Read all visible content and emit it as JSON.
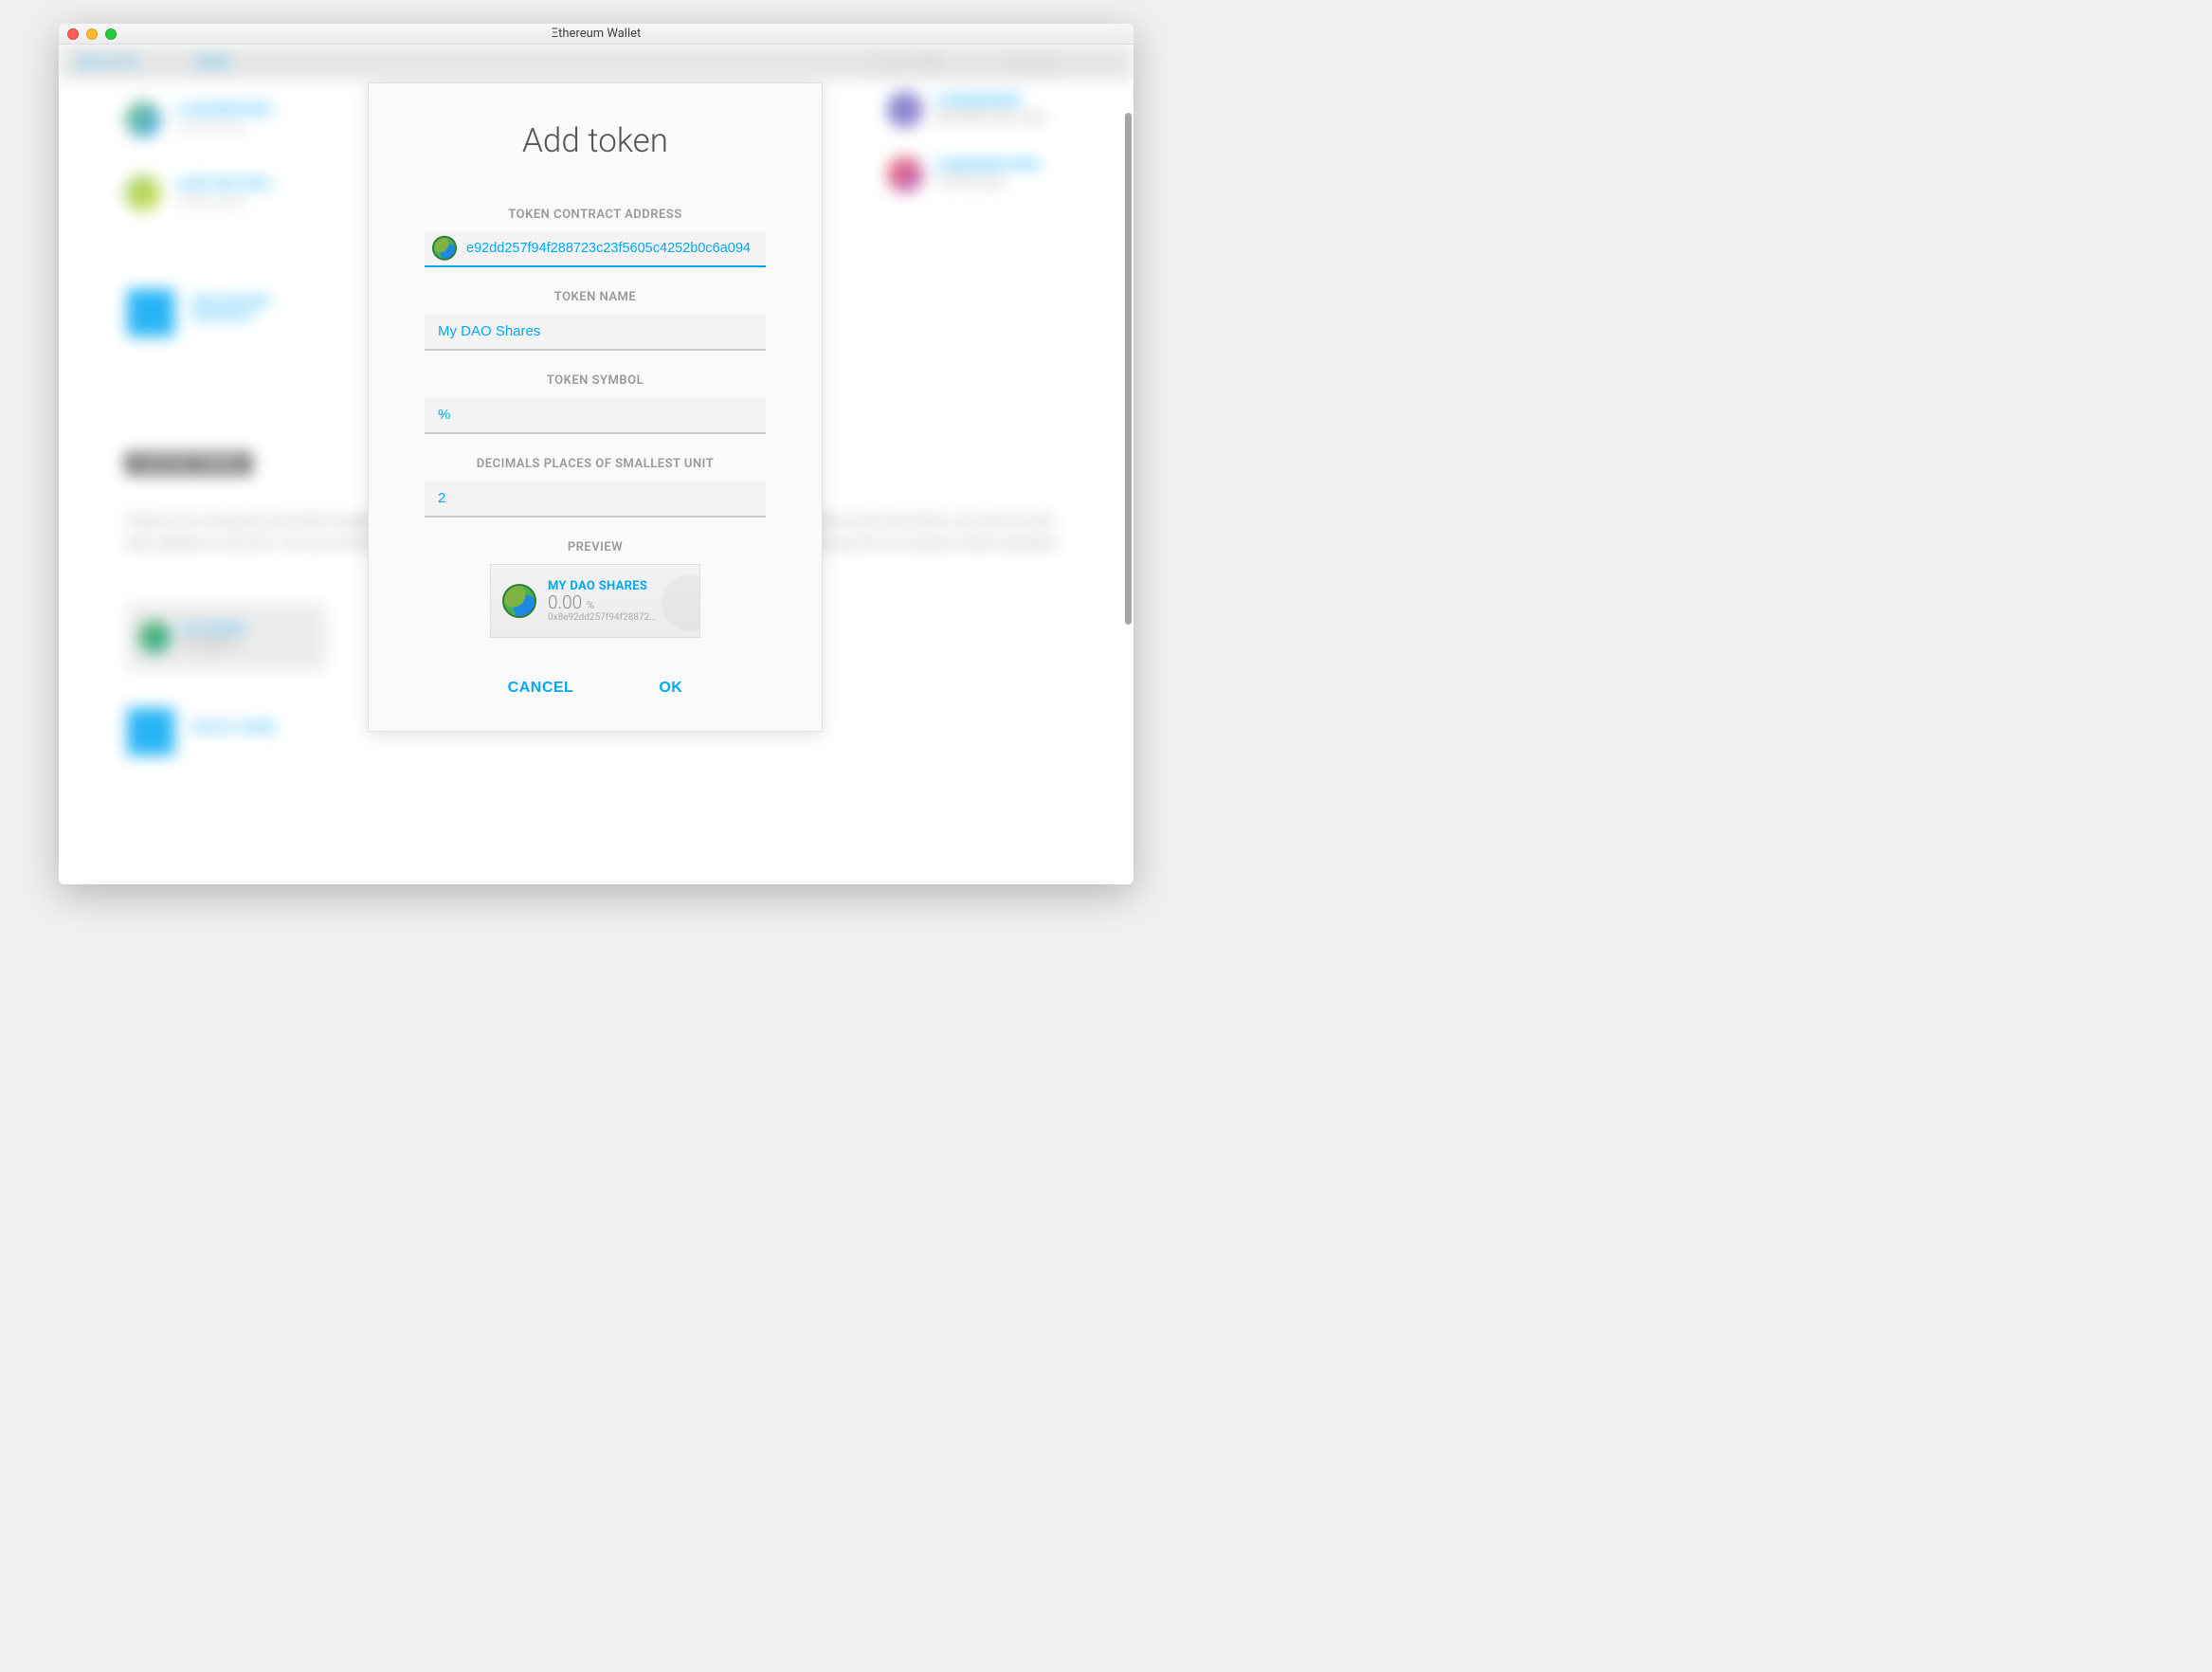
{
  "window": {
    "title": "Ξthereum Wallet"
  },
  "background": {
    "nav_wallets": "WALLETS",
    "nav_send": "SEND",
    "balance": "1,727.38",
    "balance_unit": "ETHER",
    "add_contract": "ADD CUSTOM CONTRACT",
    "section_tokens": "CUSTOM TOKENS",
    "body_text": "Tokens are currencies and other fungibles built on the Ethereum platform. In order for accounts to watch for tokens and send them, you have to add their address to this list. You can create your own token by simply modifying this custom token contract or learning more on Custom Token standard.",
    "watch_token": "WATCH TOKEN",
    "my_shares": "MY SHARES"
  },
  "modal": {
    "title": "Add token",
    "labels": {
      "address": "TOKEN CONTRACT ADDRESS",
      "name": "TOKEN NAME",
      "symbol": "TOKEN SYMBOL",
      "decimals": "DECIMALS PLACES OF SMALLEST UNIT",
      "preview": "PREVIEW"
    },
    "values": {
      "address": "e92dd257f94f288723c23f5605c4252b0c6a094",
      "name": "My DAO Shares",
      "symbol": "%",
      "decimals": "2"
    },
    "preview": {
      "name": "MY DAO SHARES",
      "balance": "0.00",
      "balance_unit": "%",
      "address_short": "0x8e92dd257f94f28872…"
    },
    "actions": {
      "cancel": "CANCEL",
      "ok": "OK"
    }
  }
}
